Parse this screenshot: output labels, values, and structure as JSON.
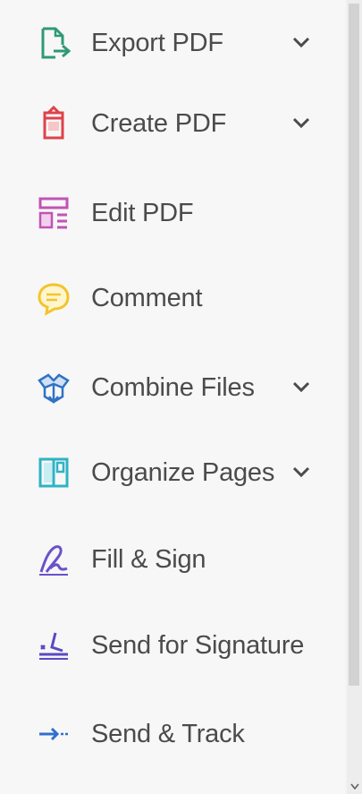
{
  "tools": [
    {
      "label": "Export PDF",
      "icon": "export-pdf-icon",
      "has_dropdown": true,
      "color": "#2f9a73"
    },
    {
      "label": "Create PDF",
      "icon": "create-pdf-icon",
      "has_dropdown": true,
      "color": "#e0424a"
    },
    {
      "label": "Edit PDF",
      "icon": "edit-pdf-icon",
      "has_dropdown": false,
      "color": "#c054b4"
    },
    {
      "label": "Comment",
      "icon": "comment-icon",
      "has_dropdown": false,
      "color": "#f2c52b"
    },
    {
      "label": "Combine Files",
      "icon": "combine-files-icon",
      "has_dropdown": true,
      "color": "#2f73c4"
    },
    {
      "label": "Organize Pages",
      "icon": "organize-pages-icon",
      "has_dropdown": true,
      "color": "#2fb3c4"
    },
    {
      "label": "Fill & Sign",
      "icon": "fill-sign-icon",
      "has_dropdown": false,
      "color": "#6a52c9"
    },
    {
      "label": "Send for Signature",
      "icon": "send-for-signature-icon",
      "has_dropdown": false,
      "color": "#5a49c2"
    },
    {
      "label": "Send & Track",
      "icon": "send-track-icon",
      "has_dropdown": false,
      "color": "#2f6fd0"
    }
  ]
}
